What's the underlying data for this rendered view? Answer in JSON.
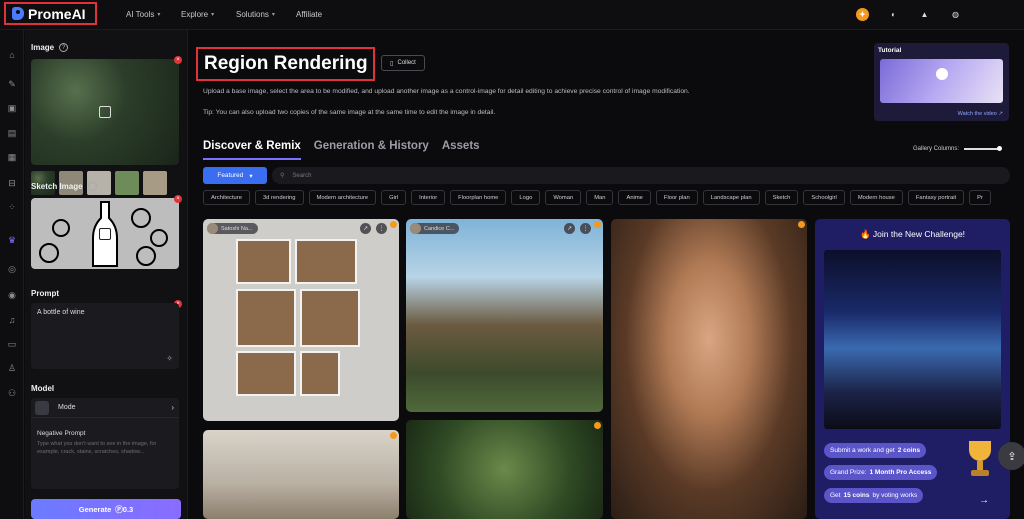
{
  "app": {
    "logo_text": "PromeAI"
  },
  "nav": {
    "ai_tools": "AI Tools",
    "explore": "Explore",
    "solutions": "Solutions",
    "affiliate": "Affiliate"
  },
  "panel": {
    "image_title": "Image",
    "sketch_title": "Sketch Image",
    "prompt_title": "Prompt",
    "prompt_value": "A bottle of wine",
    "model_title": "Model",
    "mode_label": "Mode",
    "negative_title": "Negative Prompt",
    "negative_placeholder": "Type what you don't want to see in the image, for example, crack, stains, scratches, shadow...",
    "generate_label": "Generate",
    "generate_cost": "0.3"
  },
  "page": {
    "title": "Region Rendering",
    "collect_label": "Collect",
    "description": "Upload a base image, select the area to be modified, and upload another image as a control-image for detail editing to achieve precise control of image modification.",
    "tip": "Tip: You can also upload two copies of the same image at the same time to edit the image in detail."
  },
  "tutorial": {
    "title": "Tutorial",
    "link": "Watch the video"
  },
  "tabs": [
    "Discover & Remix",
    "Generation & History",
    "Assets"
  ],
  "gallery_columns_label": "Gallery Columns:",
  "filter": {
    "featured": "Featured",
    "search_placeholder": "Search"
  },
  "chips": [
    "Architecture",
    "3d rendering",
    "Modern architecture",
    "Girl",
    "Interior",
    "Floorplan home",
    "Logo",
    "Woman",
    "Man",
    "Anime",
    "Floor plan",
    "Landscape plan",
    "Sketch",
    "Schoolgirl",
    "Modern house",
    "Fantasy portrait",
    "Pr"
  ],
  "cards": {
    "author1": "Satoshi Na...",
    "author2": "Candice C..."
  },
  "challenge": {
    "title": "Join the New Challenge!",
    "tag1_prefix": "Submit a work and get",
    "tag1_bold": "2 coins",
    "tag2_prefix": "Grand Prize:",
    "tag2_bold": "1 Month Pro Access",
    "tag3_prefix": "Get",
    "tag3_bold": "15 coins",
    "tag3_suffix": "by voting works"
  },
  "colors": {
    "accent": "#7b72ff",
    "highlight": "#e0323a",
    "featured": "#3a6df0"
  },
  "icons": [
    "coin-icon",
    "headset-icon",
    "graduation-cap-icon",
    "globe-icon",
    "home-icon",
    "brush-icon",
    "cube-icon",
    "image-icon",
    "grid-icon",
    "scan-icon",
    "apps-icon",
    "crown-icon",
    "compass-icon",
    "target-icon",
    "bell-icon",
    "folder-icon",
    "user-icon",
    "user-group-icon",
    "search-icon",
    "bookmark-icon",
    "share-icon",
    "trophy-icon"
  ]
}
